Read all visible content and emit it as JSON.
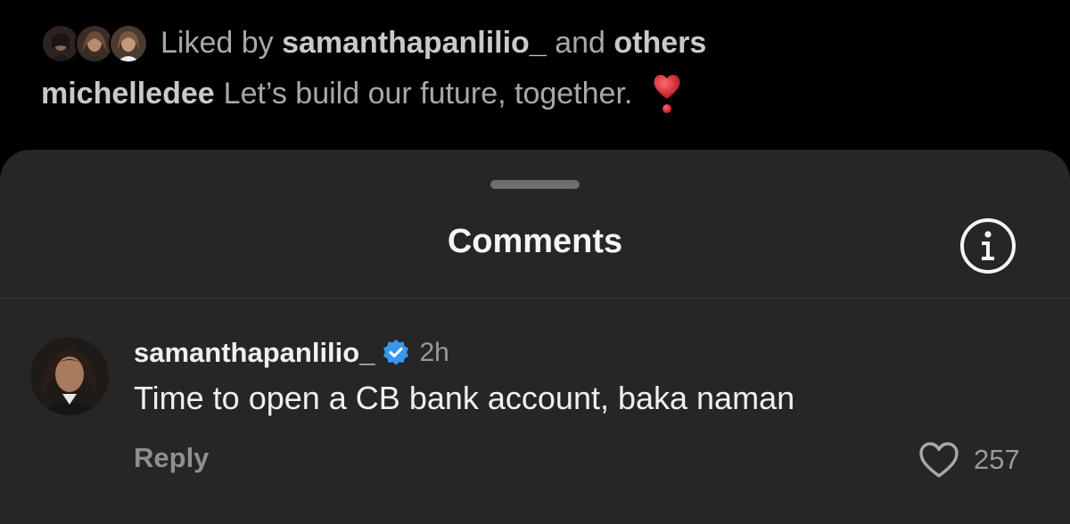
{
  "post": {
    "likes_prefix": "Liked by",
    "liked_by_user": "samanthapanlilio_",
    "likes_connector": "and",
    "likes_suffix": "others",
    "caption_user": "michelledee",
    "caption_text": "Let’s build our future, together.",
    "caption_emoji": "heart-exclamation-emoji"
  },
  "sheet": {
    "title": "Comments",
    "info_icon": "info-icon"
  },
  "comments": [
    {
      "username": "samanthapanlilio_",
      "verified": true,
      "time": "2h",
      "text": "Time to open a CB bank account, baka naman",
      "reply_label": "Reply",
      "like_count": "257"
    }
  ],
  "colors": {
    "background": "#000000",
    "sheet": "#262626",
    "verified_blue": "#3897f0",
    "heart_red": "#d0202e"
  }
}
